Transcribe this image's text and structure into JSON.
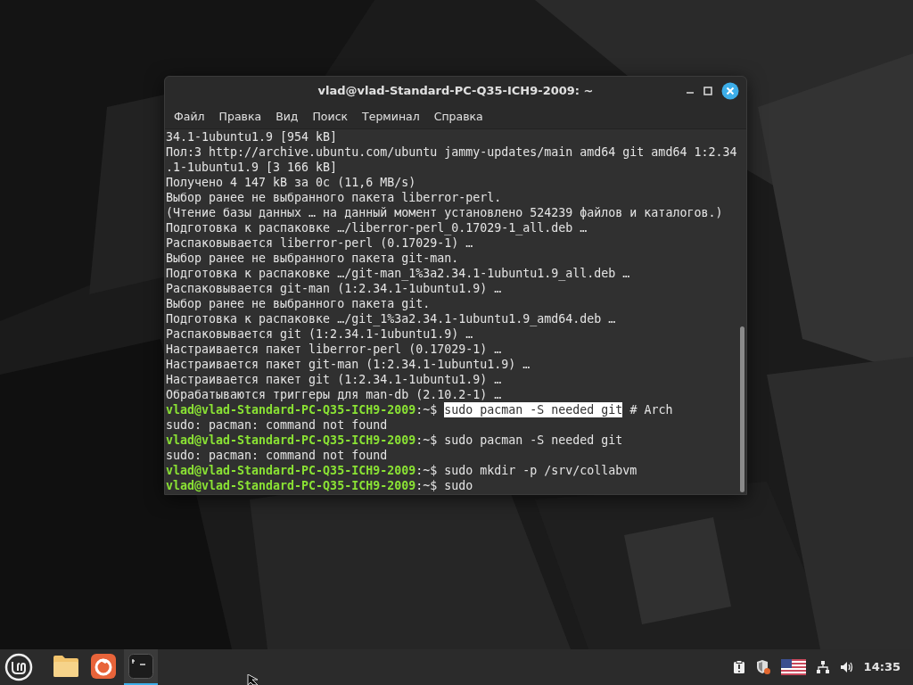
{
  "window": {
    "title": "vlad@vlad-Standard-PC-Q35-ICH9-2009: ~"
  },
  "menu": [
    "Файл",
    "Правка",
    "Вид",
    "Поиск",
    "Терминал",
    "Справка"
  ],
  "terminal": {
    "lines": [
      {
        "kind": "output",
        "text": "34.1-1ubuntu1.9 [954 kB]"
      },
      {
        "kind": "output",
        "text": "Пол:3 http://archive.ubuntu.com/ubuntu jammy-updates/main amd64 git amd64 1:2.34"
      },
      {
        "kind": "output",
        "text": ".1-1ubuntu1.9 [3 166 kB]"
      },
      {
        "kind": "output",
        "text": "Получено 4 147 kB за 0c (11,6 MB/s)"
      },
      {
        "kind": "output",
        "text": "Выбор ранее не выбранного пакета liberror-perl."
      },
      {
        "kind": "output",
        "text": "(Чтение базы данных … на данный момент установлено 524239 файлов и каталогов.)"
      },
      {
        "kind": "output",
        "text": "Подготовка к распаковке …/liberror-perl_0.17029-1_all.deb …"
      },
      {
        "kind": "output",
        "text": "Распаковывается liberror-perl (0.17029-1) …"
      },
      {
        "kind": "output",
        "text": "Выбор ранее не выбранного пакета git-man."
      },
      {
        "kind": "output",
        "text": "Подготовка к распаковке …/git-man_1%3a2.34.1-1ubuntu1.9_all.deb …"
      },
      {
        "kind": "output",
        "text": "Распаковывается git-man (1:2.34.1-1ubuntu1.9) …"
      },
      {
        "kind": "output",
        "text": "Выбор ранее не выбранного пакета git."
      },
      {
        "kind": "output",
        "text": "Подготовка к распаковке …/git_1%3a2.34.1-1ubuntu1.9_amd64.deb …"
      },
      {
        "kind": "output",
        "text": "Распаковывается git (1:2.34.1-1ubuntu1.9) …"
      },
      {
        "kind": "output",
        "text": "Настраивается пакет liberror-perl (0.17029-1) …"
      },
      {
        "kind": "output",
        "text": "Настраивается пакет git-man (1:2.34.1-1ubuntu1.9) …"
      },
      {
        "kind": "output",
        "text": "Настраивается пакет git (1:2.34.1-1ubuntu1.9) …"
      },
      {
        "kind": "output",
        "text": "Обрабатываются триггеры для man-db (2.10.2-1) …"
      },
      {
        "kind": "prompt",
        "user": "vlad@vlad-Standard-PC-Q35-ICH9-2009",
        "path": ":~$",
        "command": "sudo pacman -S needed git",
        "selected": true,
        "comment": "# Arch"
      },
      {
        "kind": "output",
        "text": "sudo: pacman: command not found"
      },
      {
        "kind": "prompt",
        "user": "vlad@vlad-Standard-PC-Q35-ICH9-2009",
        "path": ":~$",
        "command": "sudo pacman -S needed git",
        "selected": false
      },
      {
        "kind": "output",
        "text": "sudo: pacman: command not found"
      },
      {
        "kind": "prompt",
        "user": "vlad@vlad-Standard-PC-Q35-ICH9-2009",
        "path": ":~$",
        "command": "sudo mkdir -p /srv/collabvm",
        "selected": false
      },
      {
        "kind": "prompt",
        "user": "vlad@vlad-Standard-PC-Q35-ICH9-2009",
        "path": ":~$",
        "command": "sudo",
        "selected": false
      }
    ]
  },
  "taskbar": {
    "apps": [
      {
        "kind": "files",
        "selected": false
      },
      {
        "kind": "browser",
        "selected": false
      },
      {
        "kind": "terminal",
        "selected": true
      }
    ],
    "clock": "14:35"
  }
}
